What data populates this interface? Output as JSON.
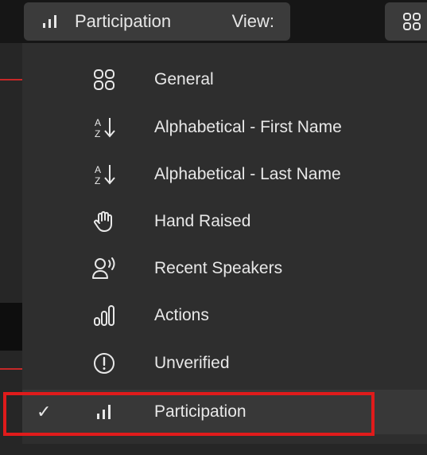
{
  "toolbar": {
    "sort_label": "Participation",
    "view_label": "View:",
    "sort_icon": "bars-icon",
    "view_icon": "grid-icon"
  },
  "menu": {
    "items": [
      {
        "label": "General",
        "icon": "grid-icon",
        "selected": false
      },
      {
        "label": "Alphabetical - First Name",
        "icon": "sort-az-icon",
        "selected": false
      },
      {
        "label": "Alphabetical - Last Name",
        "icon": "sort-az-icon",
        "selected": false
      },
      {
        "label": "Hand Raised",
        "icon": "hand-icon",
        "selected": false
      },
      {
        "label": "Recent Speakers",
        "icon": "speaker-icon",
        "selected": false
      },
      {
        "label": "Actions",
        "icon": "actions-bars-icon",
        "selected": false
      },
      {
        "label": "Unverified",
        "icon": "alert-circle-icon",
        "selected": false
      },
      {
        "label": "Participation",
        "icon": "bars-icon",
        "selected": true,
        "check": "✓"
      }
    ]
  },
  "colors": {
    "highlight": "#e01b1b",
    "menu_bg": "#2e2e2e",
    "text": "#e8e8e8"
  }
}
